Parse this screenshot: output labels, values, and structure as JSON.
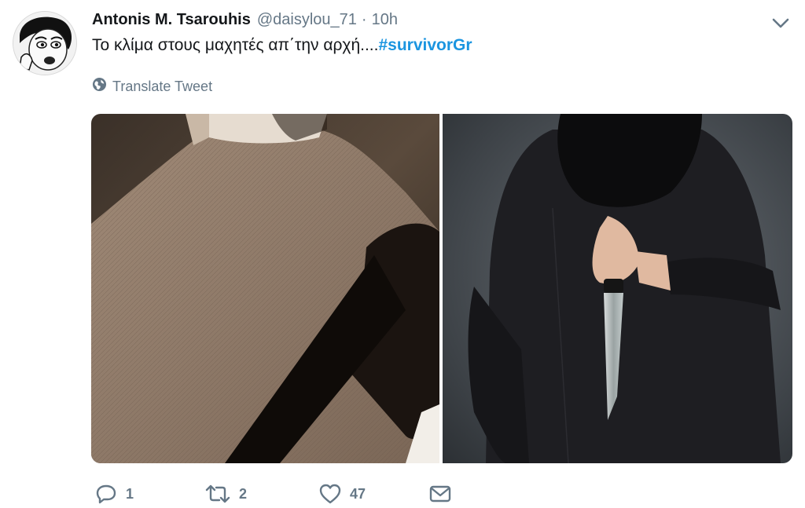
{
  "tweet": {
    "display_name": "Antonis M. Tsarouhis",
    "handle": "@daisylou_71",
    "separator": "·",
    "time": "10h",
    "text": "Το κλίμα στους μαχητές απ΄την αρχή....",
    "hashtag": "#survivorGr",
    "translate_label": "Translate Tweet"
  },
  "actions": {
    "reply_count": "1",
    "retweet_count": "2",
    "like_count": "47"
  },
  "icons": {
    "avatar": "avatar-illustration",
    "caret": "chevron-down-icon",
    "translate": "globe-icon",
    "reply": "reply-icon",
    "retweet": "retweet-icon",
    "like": "heart-icon",
    "dm": "envelope-icon"
  },
  "colors": {
    "text": "#14171a",
    "muted": "#657786",
    "link": "#1b95e0"
  }
}
